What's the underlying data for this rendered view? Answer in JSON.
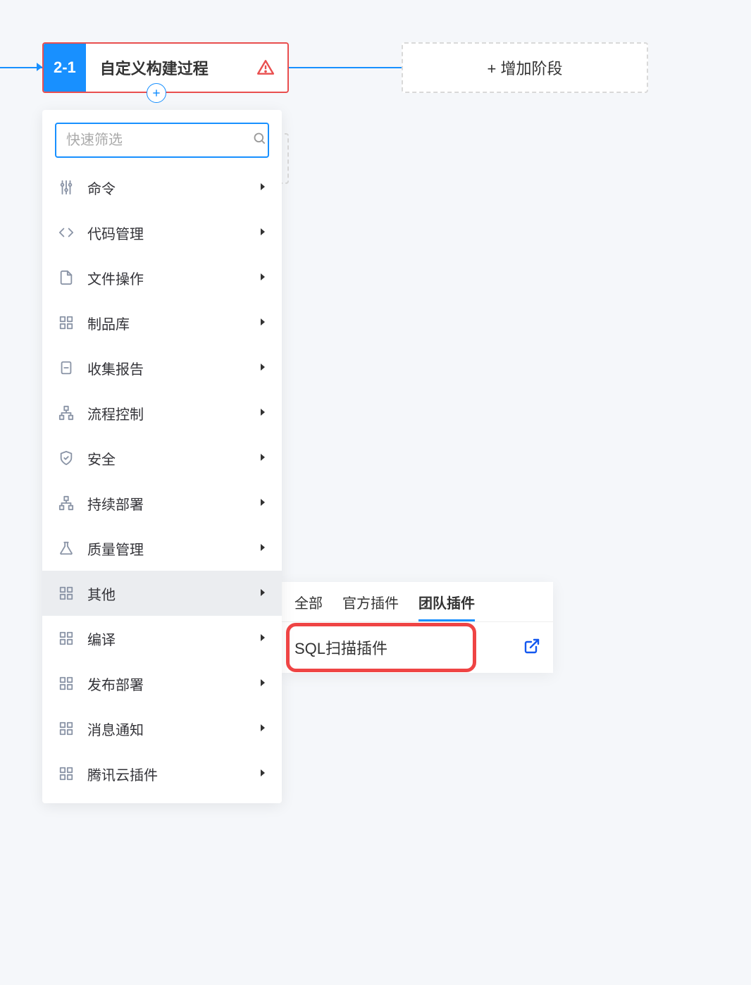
{
  "stage": {
    "number": "2-1",
    "title": "自定义构建过程"
  },
  "add_stage_label": "+ 增加阶段",
  "search": {
    "placeholder": "快速筛选"
  },
  "categories": [
    {
      "label": "命令",
      "icon": "sliders"
    },
    {
      "label": "代码管理",
      "icon": "code"
    },
    {
      "label": "文件操作",
      "icon": "file"
    },
    {
      "label": "制品库",
      "icon": "grid"
    },
    {
      "label": "收集报告",
      "icon": "clipboard"
    },
    {
      "label": "流程控制",
      "icon": "sitemap"
    },
    {
      "label": "安全",
      "icon": "shield"
    },
    {
      "label": "持续部署",
      "icon": "sitemap"
    },
    {
      "label": "质量管理",
      "icon": "flask"
    },
    {
      "label": "其他",
      "icon": "grid",
      "active": true
    },
    {
      "label": "编译",
      "icon": "grid"
    },
    {
      "label": "发布部署",
      "icon": "grid"
    },
    {
      "label": "消息通知",
      "icon": "grid"
    },
    {
      "label": "腾讯云插件",
      "icon": "grid"
    }
  ],
  "submenu": {
    "tabs": [
      {
        "label": "全部"
      },
      {
        "label": "官方插件"
      },
      {
        "label": "团队插件",
        "active": true
      }
    ],
    "plugin": "SQL扫描插件"
  }
}
